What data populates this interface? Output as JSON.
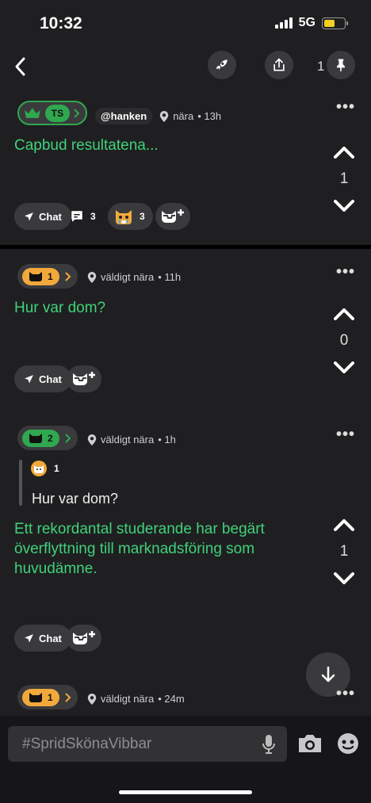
{
  "status": {
    "time": "10:32",
    "network": "5G"
  },
  "topbar": {
    "pin_count": "1"
  },
  "posts": [
    {
      "badge": "TS",
      "handle": "@hanken",
      "location": "nära",
      "time": "• 13h",
      "text": "Capbud resultatena...",
      "votes": "1",
      "chat_label": "Chat",
      "comments": "3",
      "reactions": "3"
    },
    {
      "badge": "1",
      "location": "väldigt nära",
      "time": "• 11h",
      "text": "Hur var dom?",
      "votes": "0",
      "chat_label": "Chat"
    },
    {
      "badge": "2",
      "location": "väldigt nära",
      "time": "• 1h",
      "quote_badge": "1",
      "quote_text": "Hur var dom?",
      "text": "Ett rekordantal studerande har begärt överflyttning till marknadsföring som huvudämne.",
      "votes": "1",
      "chat_label": "Chat"
    },
    {
      "badge": "1",
      "location": "väldigt nära",
      "time": "• 24m"
    }
  ],
  "composer": {
    "placeholder": "#SpridSkönaVibbar"
  },
  "colors": {
    "accent_green": "#3fd27a",
    "badge_orange": "#f2a93b",
    "badge_green": "#2fa84f",
    "battery": "#f5cf22"
  }
}
